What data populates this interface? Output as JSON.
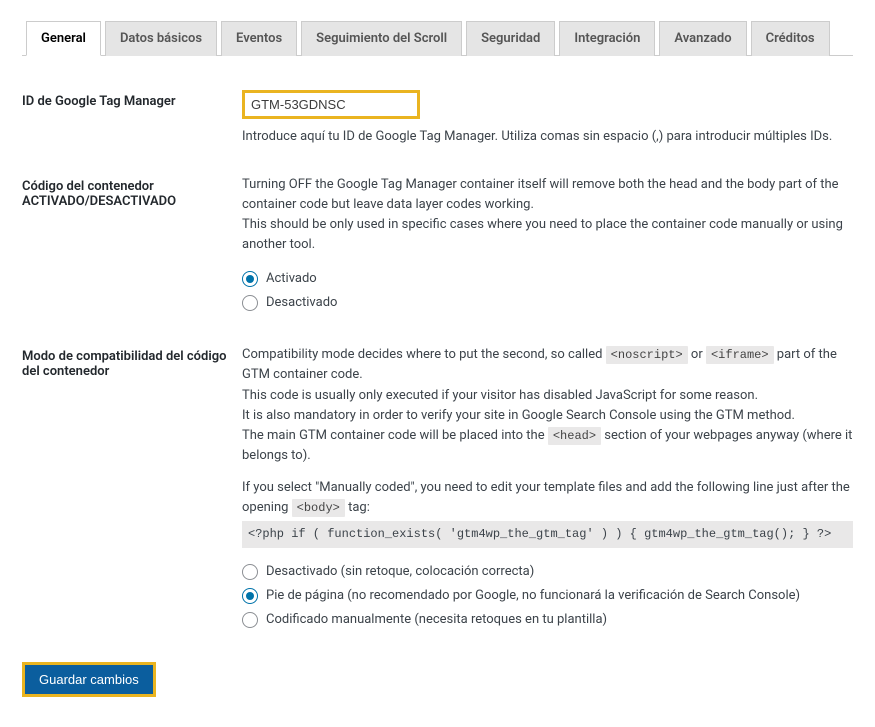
{
  "tabs": {
    "general": "General",
    "datos": "Datos básicos",
    "eventos": "Eventos",
    "scroll": "Seguimiento del Scroll",
    "seguridad": "Seguridad",
    "integracion": "Integración",
    "avanzado": "Avanzado",
    "creditos": "Créditos"
  },
  "gtm_id": {
    "label": "ID de Google Tag Manager",
    "value": "GTM-53GDNSC",
    "desc": "Introduce aquí tu ID de Google Tag Manager. Utiliza comas sin espacio (,) para introducir múltiples IDs."
  },
  "container": {
    "label": "Código del contenedor ACTIVADO/DESACTIVADO",
    "desc1": "Turning OFF the Google Tag Manager container itself will remove both the head and the body part of the container code but leave data layer codes working.",
    "desc2": "This should be only used in specific cases where you need to place the container code manually or using another tool.",
    "opt_on": "Activado",
    "opt_off": "Desactivado"
  },
  "compat": {
    "label": "Modo de compatibilidad del código del contenedor",
    "p1a": "Compatibility mode decides where to put the second, so called ",
    "code1": "<noscript>",
    "p1b": " or ",
    "code2": "<iframe>",
    "p1c": " part of the GTM container code.",
    "p2": "This code is usually only executed if your visitor has disabled JavaScript for some reason.",
    "p3": "It is also mandatory in order to verify your site in Google Search Console using the GTM method.",
    "p4a": "The main GTM container code will be placed into the ",
    "code3": "<head>",
    "p4b": " section of your webpages anyway (where it belongs to).",
    "p5a": "If you select \"Manually coded\", you need to edit your template files and add the following line just after the opening ",
    "code4": "<body>",
    "p5b": " tag:",
    "codeblock": "<?php if ( function_exists( 'gtm4wp_the_gtm_tag' ) ) { gtm4wp_the_gtm_tag(); } ?>",
    "opt_off": "Desactivado (sin retoque, colocación correcta)",
    "opt_footer": "Pie de página (no recomendado por Google, no funcionará la verificación de Search Console)",
    "opt_manual": "Codificado manualmente (necesita retoques en tu plantilla)"
  },
  "submit": "Guardar cambios"
}
